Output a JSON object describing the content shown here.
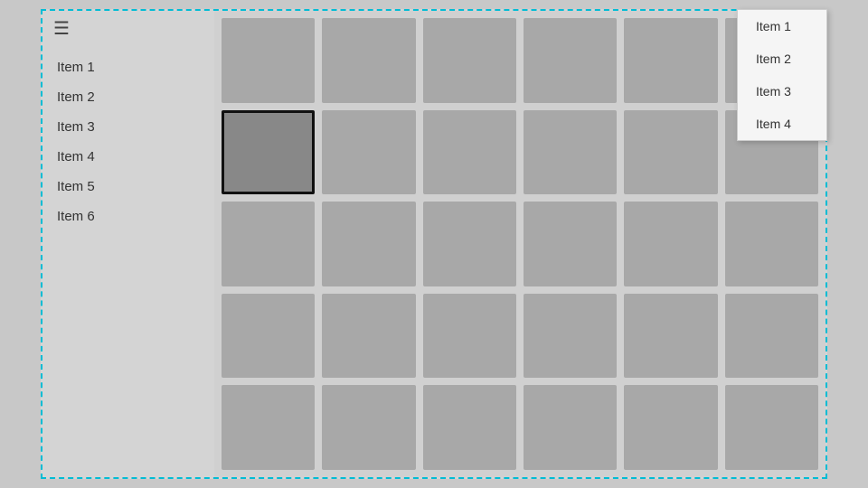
{
  "sidebar": {
    "hamburger_label": "☰",
    "items": [
      {
        "label": "Item 1",
        "id": "sidebar-item-1"
      },
      {
        "label": "Item 2",
        "id": "sidebar-item-2"
      },
      {
        "label": "Item 3",
        "id": "sidebar-item-3"
      },
      {
        "label": "Item 4",
        "id": "sidebar-item-4"
      },
      {
        "label": "Item 5",
        "id": "sidebar-item-5"
      },
      {
        "label": "Item 6",
        "id": "sidebar-item-6"
      }
    ]
  },
  "grid": {
    "rows": 5,
    "cols": 6,
    "selected_index": 6
  },
  "dropdown": {
    "items": [
      {
        "label": "Item 1"
      },
      {
        "label": "Item 2"
      },
      {
        "label": "Item 3"
      },
      {
        "label": "Item 4"
      }
    ]
  }
}
